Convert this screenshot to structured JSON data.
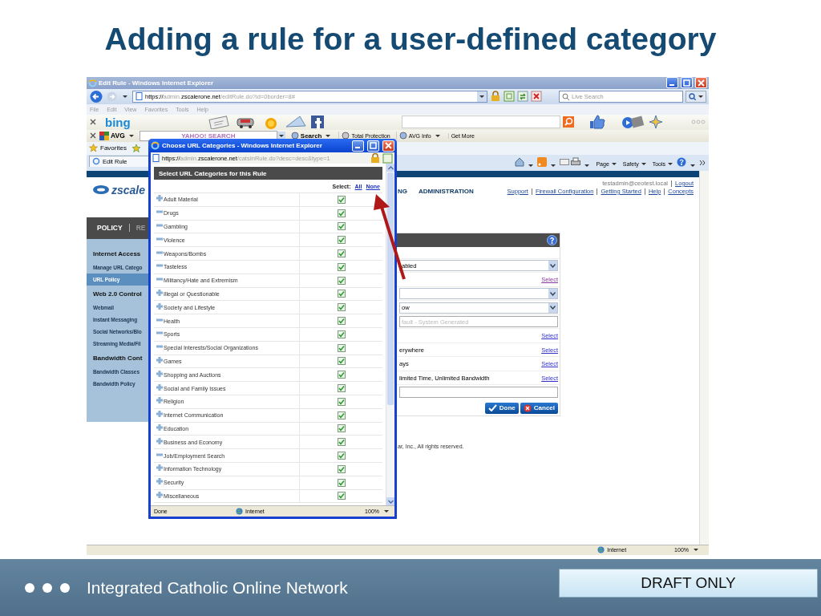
{
  "slide": {
    "title": "Adding a rule for a user-defined category",
    "footer": "Integrated Catholic Online Network",
    "stamp": "DRAFT ONLY"
  },
  "browser": {
    "title": "Edit Rule - Windows Internet Explorer",
    "address_parts": [
      {
        "text": "https://",
        "dim": false
      },
      {
        "text": "admin.",
        "dim": true
      },
      {
        "text": "zscalerone.net",
        "dim": false
      },
      {
        "text": "/editRule.do?id=0border=8#",
        "dim": true
      }
    ],
    "search_placeholder": "Live Search",
    "menu": [
      "File",
      "Edit",
      "View",
      "Favorites",
      "Tools",
      "Help"
    ],
    "bing_logo": "bing",
    "avg_logo": "AVG",
    "yahoo_placeholder": "YAHOO! SEARCH",
    "avg_items": [
      "Search",
      "Total Protection",
      "AVG Info",
      "Get More"
    ],
    "favorites": "Favorites",
    "tab": "Edit Rule",
    "commands": [
      "Page",
      "Safety",
      "Tools"
    ],
    "status": {
      "zone": "Internet",
      "zoom": "100%"
    }
  },
  "page": {
    "logo": "zscale",
    "nav": [
      "NG",
      "ADMINISTRATION"
    ],
    "user": "testadmin@ceotest.local",
    "links": [
      "Logout",
      "Support",
      "Firewall Configuration",
      "Getting Started",
      "Help",
      "Concepts"
    ],
    "policy": "POLICY",
    "policy_next": "RE",
    "sidebar": [
      {
        "label": "Internet Access",
        "kind": "heading"
      },
      {
        "label": "Manage URL Catego",
        "kind": "item",
        "selected": false
      },
      {
        "label": "URL Policy",
        "kind": "item",
        "selected": true
      },
      {
        "label": "Web 2.0 Control",
        "kind": "heading"
      },
      {
        "label": "Webmail",
        "kind": "item",
        "selected": false
      },
      {
        "label": "Instant Messaging",
        "kind": "item",
        "selected": false
      },
      {
        "label": "Social Networks/Blo",
        "kind": "item",
        "selected": false
      },
      {
        "label": "Streaming Media/Fil",
        "kind": "item",
        "selected": false
      },
      {
        "label": "Bandwidth Cont",
        "kind": "heading"
      },
      {
        "label": "Bandwidth Classes",
        "kind": "item",
        "selected": false
      },
      {
        "label": "Bandwidth Policy",
        "kind": "item",
        "selected": false
      }
    ],
    "form": [
      {
        "kind": "select",
        "value": "abled"
      },
      {
        "kind": "link",
        "link": "Select",
        "visited": true
      },
      {
        "kind": "select"
      },
      {
        "kind": "select",
        "value": "ow"
      },
      {
        "kind": "input",
        "placeholder": "fault - System Generated"
      },
      {
        "kind": "link",
        "link": "Select",
        "visited": false
      },
      {
        "kind": "link",
        "value": "erywhere",
        "link": "Select",
        "visited": false
      },
      {
        "kind": "link",
        "value": "ays",
        "link": "Select",
        "visited": false
      },
      {
        "kind": "link",
        "value": "limited Time, Unlimited Bandwidth",
        "link": "Select",
        "visited": false
      },
      {
        "kind": "input"
      }
    ],
    "buttons": [
      {
        "label": "Done",
        "kind": "confirm"
      },
      {
        "label": "Cancel",
        "kind": "cancel"
      }
    ],
    "copyright": "ar, Inc., All rights reserved."
  },
  "popup": {
    "title": "Choose URL Categories - Windows Internet Explorer",
    "address_parts": [
      {
        "text": "https://",
        "dim": false
      },
      {
        "text": "admin.",
        "dim": true
      },
      {
        "text": "zscalerone.net",
        "dim": false
      },
      {
        "text": "/catsInRule.do?desc=desc&type=1",
        "dim": true
      }
    ],
    "heading": "Select URL Categories for this Rule",
    "select_label": "Select:",
    "select_links": [
      "All",
      "None"
    ],
    "categories": [
      {
        "name": "Adult Material",
        "expanded": false,
        "checked": true
      },
      {
        "name": "Drugs",
        "expanded": true,
        "checked": true
      },
      {
        "name": "Gambling",
        "expanded": true,
        "checked": true
      },
      {
        "name": "Violence",
        "expanded": true,
        "checked": true
      },
      {
        "name": "Weapons/Bombs",
        "expanded": true,
        "checked": true
      },
      {
        "name": "Tasteless",
        "expanded": true,
        "checked": true
      },
      {
        "name": "Militancy/Hate and Extremism",
        "expanded": true,
        "checked": true
      },
      {
        "name": "Illegal or Questionable",
        "expanded": false,
        "checked": true
      },
      {
        "name": "Society and Lifestyle",
        "expanded": false,
        "checked": true
      },
      {
        "name": "Health",
        "expanded": true,
        "checked": true
      },
      {
        "name": "Sports",
        "expanded": true,
        "checked": true
      },
      {
        "name": "Special Interests/Social Organizations",
        "expanded": true,
        "checked": true
      },
      {
        "name": "Games",
        "expanded": false,
        "checked": true
      },
      {
        "name": "Shopping and Auctions",
        "expanded": false,
        "checked": true
      },
      {
        "name": "Social and Family Issues",
        "expanded": false,
        "checked": true
      },
      {
        "name": "Religion",
        "expanded": false,
        "checked": true
      },
      {
        "name": "Internet Communication",
        "expanded": false,
        "checked": true
      },
      {
        "name": "Education",
        "expanded": false,
        "checked": true
      },
      {
        "name": "Business and Economy",
        "expanded": false,
        "checked": true
      },
      {
        "name": "Job/Employment Search",
        "expanded": true,
        "checked": true
      },
      {
        "name": "Information Technology",
        "expanded": false,
        "checked": true
      },
      {
        "name": "Security",
        "expanded": false,
        "checked": true
      },
      {
        "name": "Miscellaneous",
        "expanded": false,
        "checked": true
      }
    ],
    "status": {
      "left": "Done",
      "zone": "Internet",
      "zoom": "100%"
    }
  }
}
